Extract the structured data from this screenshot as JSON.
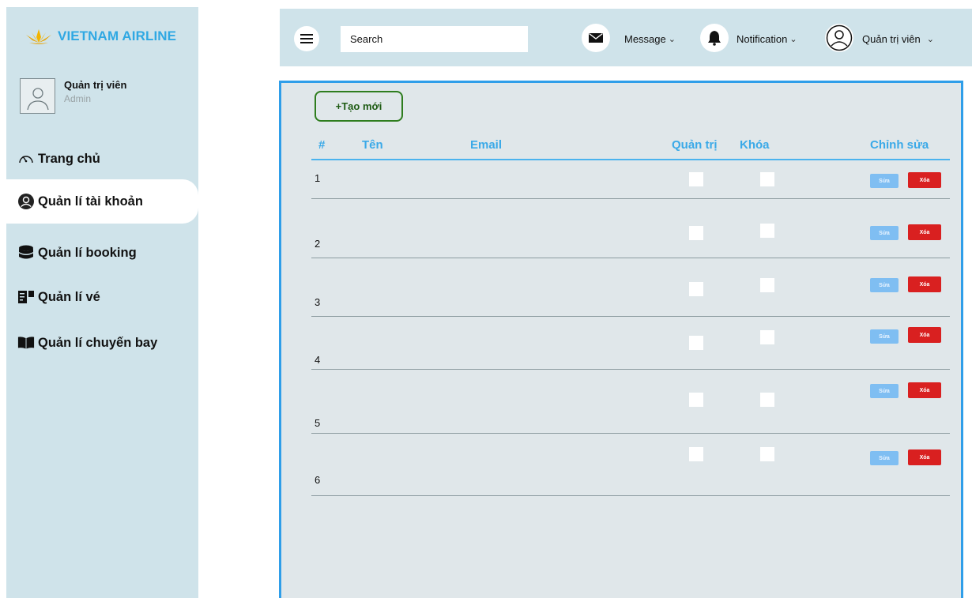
{
  "brand": {
    "name": "VIETNAM AIRLINE",
    "logo_icon": "lotus-icon",
    "color": "#2fa8e3"
  },
  "profile": {
    "name": "Quản trị viên",
    "role": "Admin"
  },
  "sidebar": {
    "items": [
      {
        "label": "Trang chủ",
        "icon": "dashboard-gauge-icon",
        "active": false
      },
      {
        "label": "Quản lí tài khoản",
        "icon": "user-circle-icon",
        "active": true
      },
      {
        "label": "Quản lí booking",
        "icon": "database-icon",
        "active": false
      },
      {
        "label": "Quản lí vé",
        "icon": "ticket-icon",
        "active": false
      },
      {
        "label": "Quản lí chuyến bay",
        "icon": "book-icon",
        "active": false
      }
    ]
  },
  "topbar": {
    "search_placeholder": "Search",
    "message_label": "Message",
    "notification_label": "Notification",
    "user_label": "Quản trị viên"
  },
  "table": {
    "create_label": "+Tạo mới",
    "headers": {
      "num": "#",
      "name": "Tên",
      "email": "Email",
      "admin": "Quản trị",
      "lock": "Khóa",
      "edit": "Chỉnh sửa"
    },
    "edit_label": "Sửa",
    "delete_label": "Xóa",
    "rows": [
      {
        "num": "1",
        "admin": false,
        "locked": false
      },
      {
        "num": "2",
        "admin": false,
        "locked": false
      },
      {
        "num": "3",
        "admin": false,
        "locked": false
      },
      {
        "num": "4",
        "admin": false,
        "locked": false
      },
      {
        "num": "5",
        "admin": false,
        "locked": false
      },
      {
        "num": "6",
        "admin": false,
        "locked": false
      }
    ]
  },
  "colors": {
    "sidebar_bg": "#cfe3ea",
    "panel_border": "#2f9ee9",
    "header_text": "#3aa9e8",
    "delete": "#d92020",
    "edit": "#7fbef2",
    "create_border": "#2e7d1e"
  }
}
